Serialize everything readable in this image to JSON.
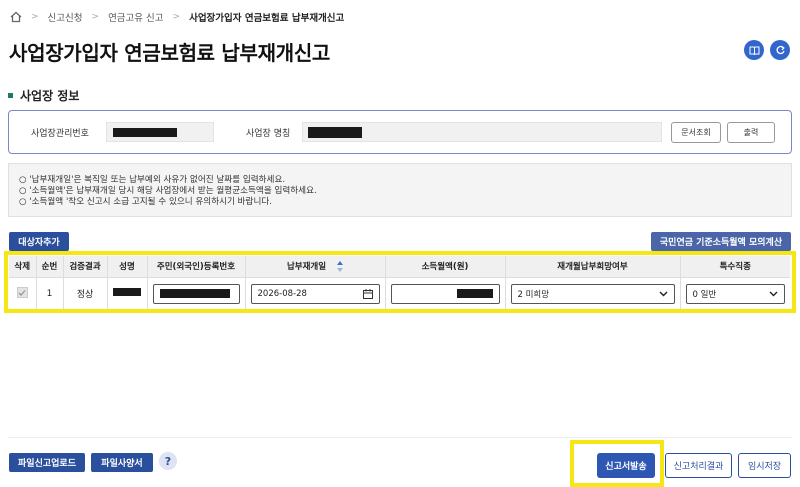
{
  "breadcrumb": {
    "items": [
      "신고신청",
      "연금고유 신고"
    ],
    "current": "사업장가입자 연금보험료 납부재개신고"
  },
  "page": {
    "title": "사업장가입자 연금보험료 납부재개신고"
  },
  "section": {
    "title": "사업장 정보"
  },
  "workplace": {
    "mgmt_no_label": "사업장관리번호",
    "name_label": "사업장 명칭",
    "doc_lookup_label": "문서조회",
    "print_label": "출력"
  },
  "notice": {
    "lines": [
      "○ '납부재개일'은 복직일 또는 납부예외 사유가 없어진 날짜를 입력하세요.",
      "○ '소득월액'은 납부재개일 당시 해당 사업장에서 받는 월평균소득액을 입력하세요.",
      "○ '소득월액 '착오 신고시 소급 고지될 수 있으니 유의하시기 바랍니다."
    ]
  },
  "toolbar": {
    "add_target_label": "대상자추가",
    "simulate_label": "국민연금 기준소득월액 모의계산"
  },
  "table": {
    "headers": [
      "삭제",
      "순번",
      "검증결과",
      "성명",
      "주민(외국인)등록번호",
      "납부재개일",
      "소득월액(원)",
      "재개월납부희망여부",
      "특수직종"
    ],
    "rows": [
      {
        "seq": "1",
        "verify": "정상",
        "resume_date": "2026-08-28",
        "hope": "2 미희망",
        "special": "0 일반"
      }
    ]
  },
  "footer": {
    "file_upload_label": "파일신고업로드",
    "file_spec_label": "파일사양서",
    "help_label": "?",
    "submit_label": "신고서발송",
    "result_label": "신고처리결과",
    "temp_save_label": "임시저장"
  },
  "colors": {
    "primary": "#2a4f9c",
    "highlight": "#f5e614",
    "accent_green": "#1f7a5a"
  }
}
